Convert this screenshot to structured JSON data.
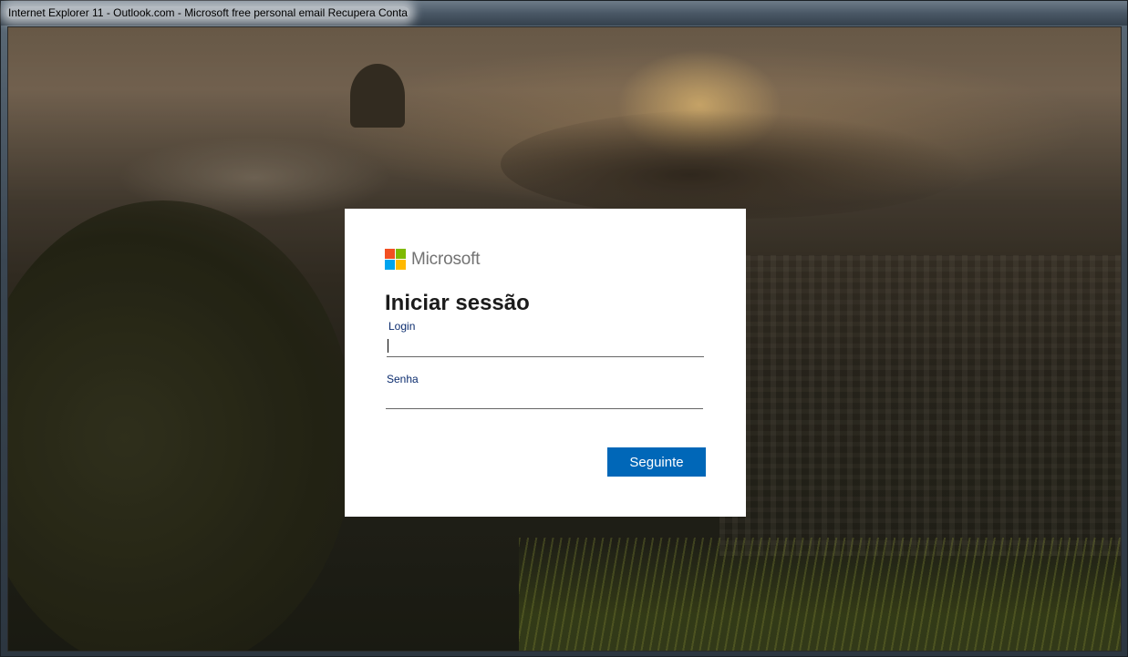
{
  "window": {
    "title": "Internet Explorer 11 - Outlook.com - Microsoft free personal email Recupera Conta"
  },
  "brand": {
    "wordmark": "Microsoft",
    "logo_colors": [
      "#f25022",
      "#7fba00",
      "#00a4ef",
      "#ffb900"
    ]
  },
  "signin": {
    "title": "Iniciar sessão",
    "login_label": "Login",
    "login_value": "",
    "password_label": "Senha",
    "password_value": "",
    "next_button_label": "Seguinte"
  },
  "colors": {
    "accent": "#0067b8",
    "label": "#0b2c6e"
  }
}
